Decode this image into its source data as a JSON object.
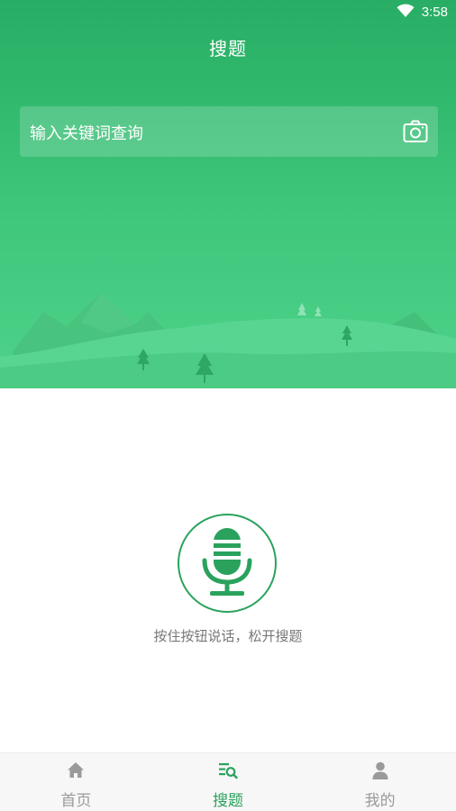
{
  "status_bar": {
    "time": "3:58",
    "wifi_icon": "wifi-icon"
  },
  "header": {
    "title": "搜题"
  },
  "search": {
    "placeholder": "输入关键词查询",
    "camera_icon": "camera-icon"
  },
  "voice": {
    "mic_icon": "microphone-icon",
    "hint": "按住按钮说话，松开搜题"
  },
  "tabs": [
    {
      "label": "首页",
      "icon": "home-icon",
      "active": false
    },
    {
      "label": "搜题",
      "icon": "search-list-icon",
      "active": true
    },
    {
      "label": "我的",
      "icon": "user-icon",
      "active": false
    }
  ],
  "colors": {
    "brand_green": "#2aa25d",
    "header_green": "#29ad65",
    "inactive_tab": "#9a9a9a"
  }
}
